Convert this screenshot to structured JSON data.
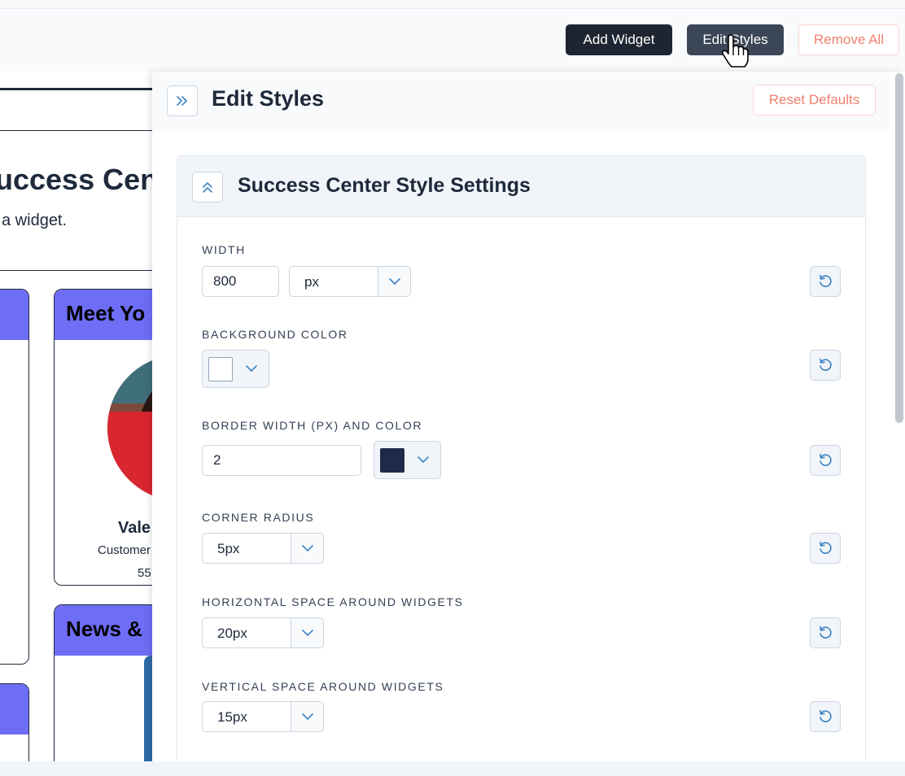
{
  "toolbar": {
    "add_widget": "Add Widget",
    "edit_styles": "Edit Styles",
    "remove_all": "Remove All"
  },
  "background_page": {
    "title": "uccess Cente",
    "subtitle": "a widget.",
    "card_meet_title": "Meet Yo",
    "card_news_title": "News &",
    "person_name": "Vale",
    "person_role": "Customer",
    "person_phone": "55"
  },
  "panel": {
    "title": "Edit Styles",
    "reset_label": "Reset Defaults",
    "section_title": "Success Center Style Settings",
    "fields": {
      "width_label": "WIDTH",
      "width_value": "800",
      "width_unit": "px",
      "bg_color_label": "BACKGROUND COLOR",
      "bg_color": "#ffffff",
      "border_label": "BORDER WIDTH (PX) AND COLOR",
      "border_width": "2",
      "border_color": "#1e2a4a",
      "radius_label": "CORNER RADIUS",
      "radius_value": "5px",
      "hspace_label": "HORIZONTAL SPACE AROUND WIDGETS",
      "hspace_value": "20px",
      "vspace_label": "VERTICAL SPACE AROUND WIDGETS",
      "vspace_value": "15px"
    }
  },
  "colors": {
    "accent_card_header": "#6e6df6",
    "danger_text": "#f08070",
    "dark_button": "#1e2532",
    "icon_blue": "#3b82c4"
  },
  "icons": {
    "collapse": "double-chevron-right-icon",
    "section_toggle": "double-chevron-up-icon",
    "chevron": "chevron-down-icon",
    "undo": "undo-icon",
    "cursor": "hand-pointer-icon"
  }
}
